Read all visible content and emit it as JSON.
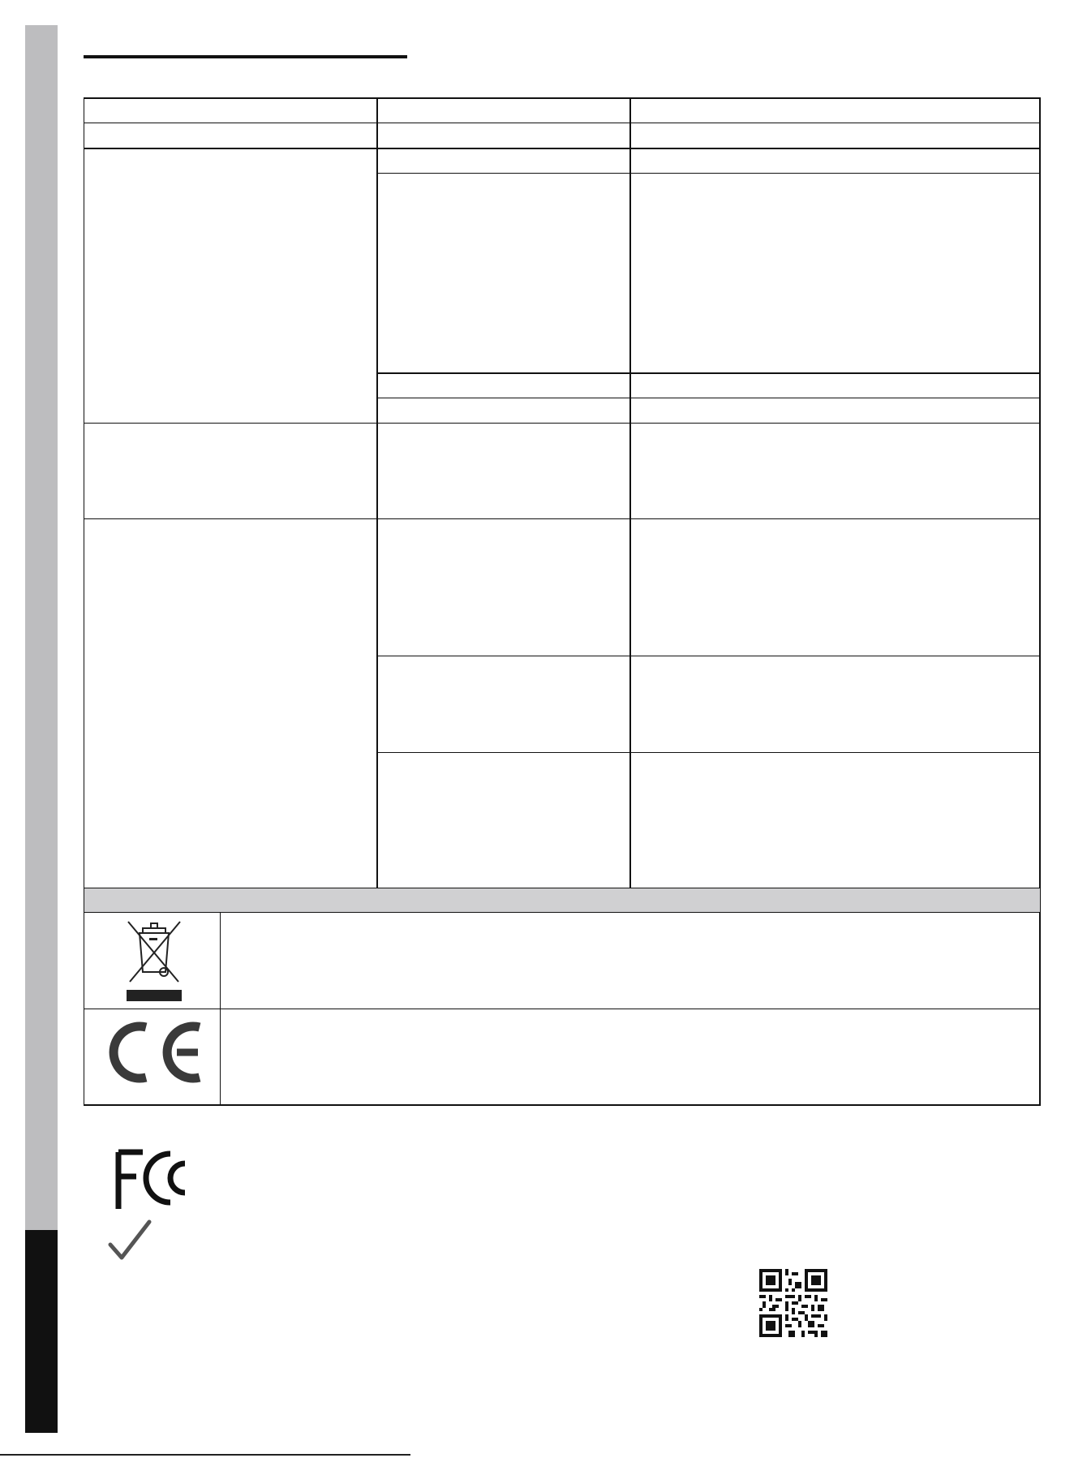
{
  "colors": {
    "side_band_light": "#bdbdbf",
    "side_band_dark": "#111111",
    "table_border": "#111111",
    "section_band": "#d0d0d2"
  },
  "icons": {
    "weee": "crossed-out-wheelie-bin-icon",
    "ce": "ce-mark-icon",
    "fcc": "fcc-logo-icon",
    "check": "checkmark-icon",
    "qr": "qr-code-icon"
  }
}
